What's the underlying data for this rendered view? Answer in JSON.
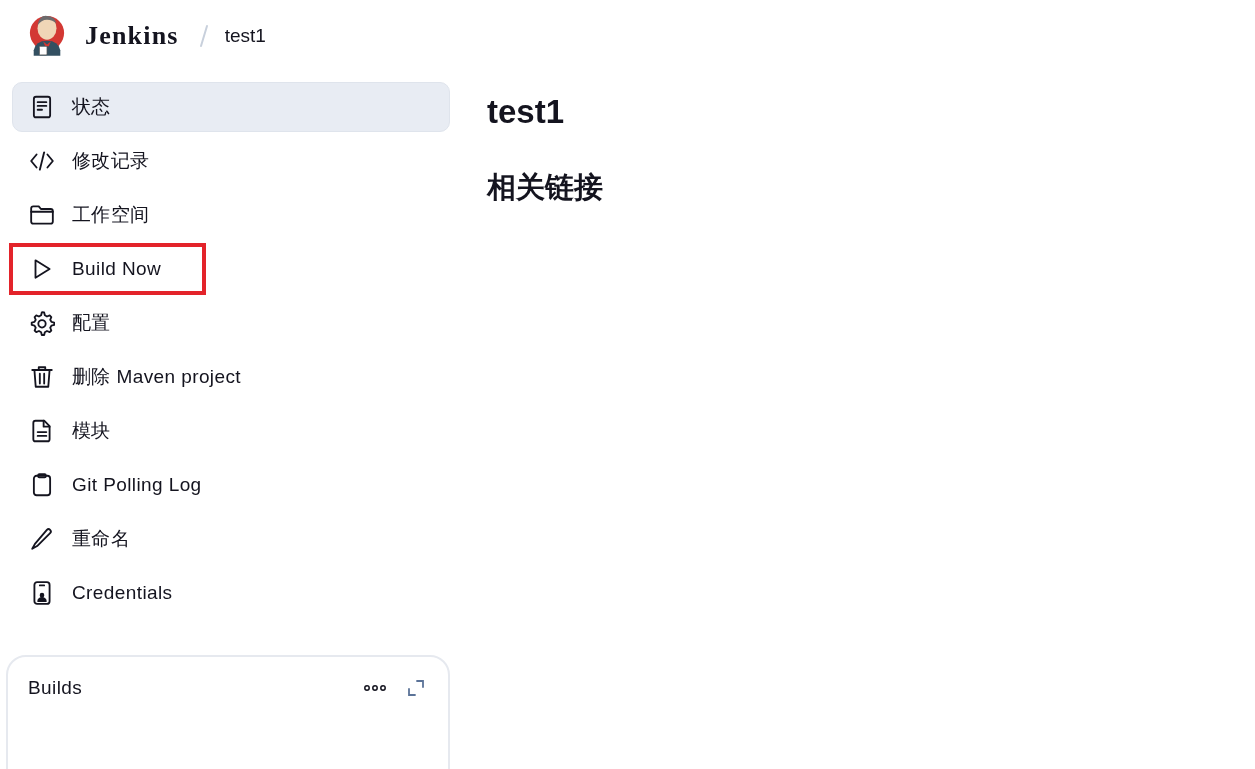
{
  "breadcrumb": {
    "home": "Jenkins",
    "current": "test1"
  },
  "sidebar": {
    "items": [
      {
        "label": "状态",
        "selected": true,
        "highlighted": false
      },
      {
        "label": "修改记录",
        "selected": false,
        "highlighted": false
      },
      {
        "label": "工作空间",
        "selected": false,
        "highlighted": false
      },
      {
        "label": "Build Now",
        "selected": false,
        "highlighted": true
      },
      {
        "label": "配置",
        "selected": false,
        "highlighted": false
      },
      {
        "label": "删除 Maven project",
        "selected": false,
        "highlighted": false
      },
      {
        "label": "模块",
        "selected": false,
        "highlighted": false
      },
      {
        "label": "Git Polling Log",
        "selected": false,
        "highlighted": false
      },
      {
        "label": "重命名",
        "selected": false,
        "highlighted": false
      },
      {
        "label": "Credentials",
        "selected": false,
        "highlighted": false
      }
    ]
  },
  "builds_panel": {
    "title": "Builds"
  },
  "main": {
    "title": "test1",
    "section_heading": "相关链接"
  }
}
